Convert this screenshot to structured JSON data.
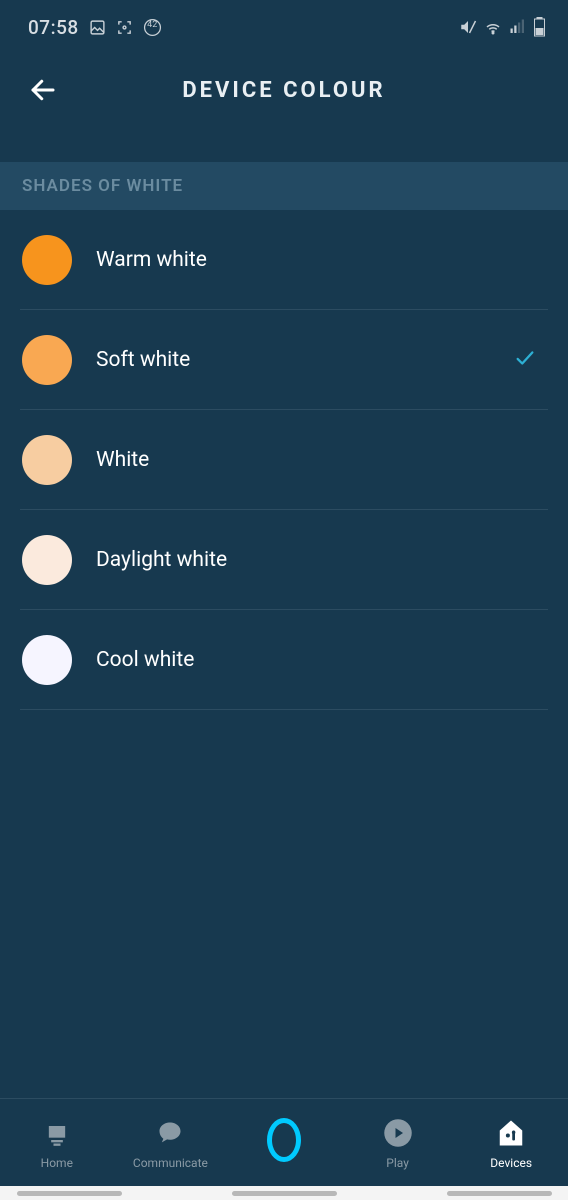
{
  "status": {
    "time": "07:58",
    "badge": "42"
  },
  "header": {
    "title": "DEVICE COLOUR"
  },
  "section": {
    "title": "SHADES OF WHITE"
  },
  "colours": [
    {
      "label": "Warm white",
      "hex": "#f7941d",
      "selected": false
    },
    {
      "label": "Soft white",
      "hex": "#f9a852",
      "selected": true
    },
    {
      "label": "White",
      "hex": "#f7cda1",
      "selected": false
    },
    {
      "label": "Daylight white",
      "hex": "#fbeadd",
      "selected": false
    },
    {
      "label": "Cool white",
      "hex": "#f6f5ff",
      "selected": false
    }
  ],
  "nav": {
    "items": [
      {
        "label": "Home"
      },
      {
        "label": "Communicate"
      },
      {
        "label": ""
      },
      {
        "label": "Play"
      },
      {
        "label": "Devices"
      }
    ],
    "active_index": 4
  }
}
